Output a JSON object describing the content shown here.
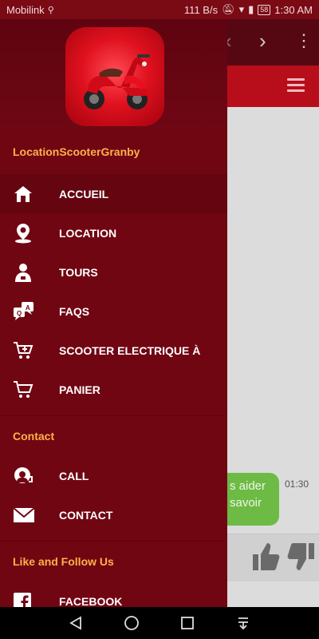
{
  "status_bar": {
    "carrier": "Mobilink",
    "usb_icon": "usb-icon",
    "net_speed": "111 B/s",
    "battery": "58",
    "time": "1:30 AM"
  },
  "drawer": {
    "app_name": "LocationScooterGranby",
    "logo_icon": "scooter-logo-icon",
    "primary_items": [
      {
        "label": "ACCUEIL",
        "icon": "home-icon"
      },
      {
        "label": "LOCATION",
        "icon": "location-pin-icon"
      },
      {
        "label": "TOURS",
        "icon": "tour-guide-icon"
      },
      {
        "label": "FAQS",
        "icon": "faq-chat-icon"
      },
      {
        "label": "SCOOTER ELECTRIQUE À",
        "icon": "cart-add-icon"
      },
      {
        "label": "PANIER",
        "icon": "cart-icon"
      }
    ],
    "contact_title": "Contact",
    "contact_items": [
      {
        "label": "CALL",
        "icon": "call-headset-icon"
      },
      {
        "label": "CONTACT",
        "icon": "mail-icon"
      }
    ],
    "follow_title": "Like and Follow Us",
    "follow_items": [
      {
        "label": "FACEBOOK",
        "icon": "facebook-icon"
      }
    ]
  },
  "background_app": {
    "chat_bubble_text": "s aider\nsavoir",
    "chat_time": "01:30"
  },
  "colors": {
    "drawer_bg": "#710613",
    "section_title": "#ffb04a",
    "accent_red": "#b80d1a",
    "chat_green": "#6dbb45"
  }
}
